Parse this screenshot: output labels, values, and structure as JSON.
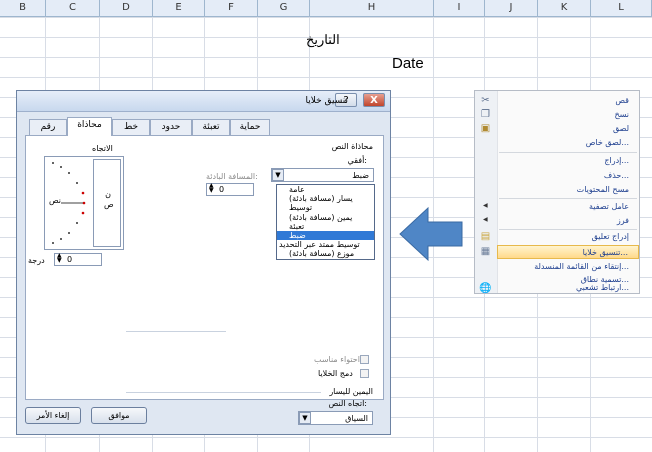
{
  "sheet": {
    "columns": [
      "B",
      "C",
      "D",
      "E",
      "F",
      "G",
      "H",
      "I",
      "J",
      "K",
      "L"
    ],
    "cell_title_ar": "التاريخ",
    "cell_title_en": "Date"
  },
  "dialog": {
    "title": "تنسيق خلايا",
    "help": "?",
    "close": "X",
    "tabs": [
      "حماية",
      "تعبئة",
      "حدود",
      "خط",
      "محاذاة",
      "رقم"
    ],
    "active_tab": "محاذاة",
    "text_alignment_heading": "محاذاة النص",
    "horizontal_label": "أفقي:",
    "horizontal_value": "ضبط",
    "horizontal_options": [
      "عامة",
      "يسار (مسافة بادئة)",
      "توسيط",
      "يمين (مسافة بادئة)",
      "تعبئة",
      "ضبط",
      "توسيط ممتد عبر التحديد",
      "موزع (مسافة بادئة)"
    ],
    "horizontal_selected_index": 5,
    "indent_label": "المسافة البادئة:",
    "indent_value": "0",
    "shrink_label": "احتواء مناسب",
    "merge_label": "دمج الخلايا",
    "rtl_heading": "اليمين لليسار",
    "text_direction_label": "اتجاه النص:",
    "text_direction_value": "السياق",
    "orientation_label": "الاتجاه",
    "orient_text": "نص",
    "vertical_text": "ن ص",
    "degrees_value": "0",
    "degrees_label": "درجة",
    "ok": "موافق",
    "cancel": "إلغاء الأمر"
  },
  "context_menu": {
    "items": [
      "قص",
      "نسخ",
      "لصق",
      "لصق خاص...",
      "إدراج...",
      "حذف...",
      "مسح المحتويات",
      "عامل تصفية",
      "فرز",
      "إدراج تعليق",
      "تنسيق خلايا...",
      "إنتقاء من القائمة المنسدلة...",
      "تسمية نطاق...",
      "ارتباط تشعبي..."
    ],
    "highlighted_index": 10
  },
  "colors": {
    "arrow": "#4f86c6",
    "selection": "#3079d6",
    "menu_highlight": "#ffd98a"
  }
}
